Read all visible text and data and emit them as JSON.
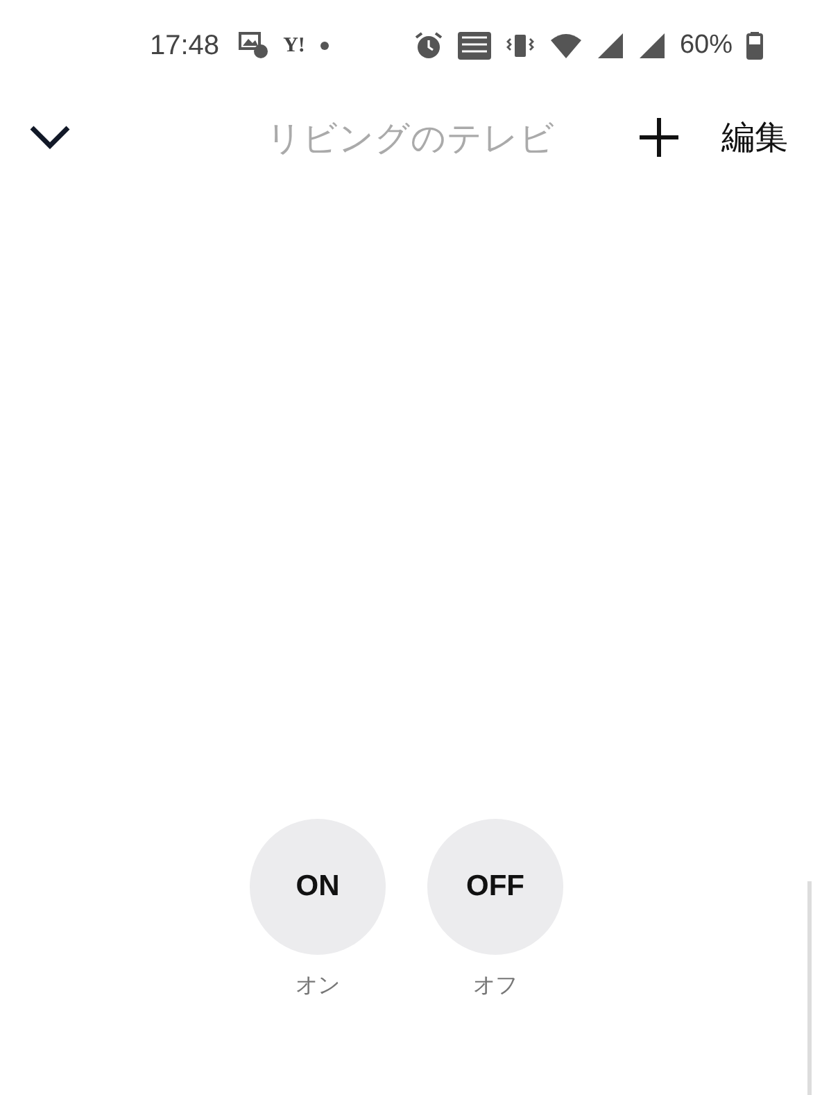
{
  "status_bar": {
    "time": "17:48",
    "app_mark": "Y!",
    "battery": "60%"
  },
  "header": {
    "title": "リビングのテレビ",
    "edit": "編集"
  },
  "buttons": [
    {
      "label": "ON",
      "caption": "オン"
    },
    {
      "label": "OFF",
      "caption": "オフ"
    }
  ]
}
